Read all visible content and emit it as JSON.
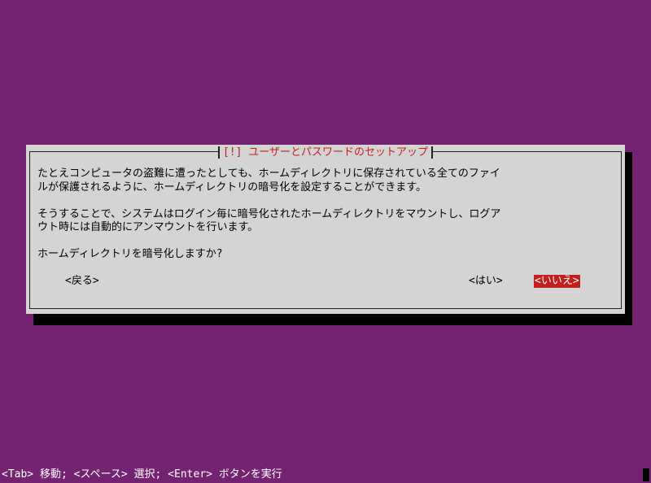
{
  "dialog": {
    "title": "[!] ユーザーとパスワードのセットアップ",
    "paragraph1_line1": "たとえコンピュータの盗難に遭ったとしても、ホームディレクトリに保存されている全てのファイ",
    "paragraph1_line2": "ルが保護されるように、ホームディレクトリの暗号化を設定することができます。",
    "paragraph2_line1": "そうすることで、システムはログイン毎に暗号化されたホームディレクトリをマウントし、ログア",
    "paragraph2_line2": "ウト時には自動的にアンマウントを行います。",
    "question": "ホームディレクトリを暗号化しますか?",
    "back_button": "<戻る>",
    "yes_button": "<はい>",
    "no_button": "<いいえ>"
  },
  "status_bar": {
    "help": "<Tab> 移動; <スペース> 選択; <Enter> ボタンを実行"
  },
  "colors": {
    "background": "#73236f",
    "dialog": "#d4d4d4",
    "accent": "#c21f1f"
  }
}
